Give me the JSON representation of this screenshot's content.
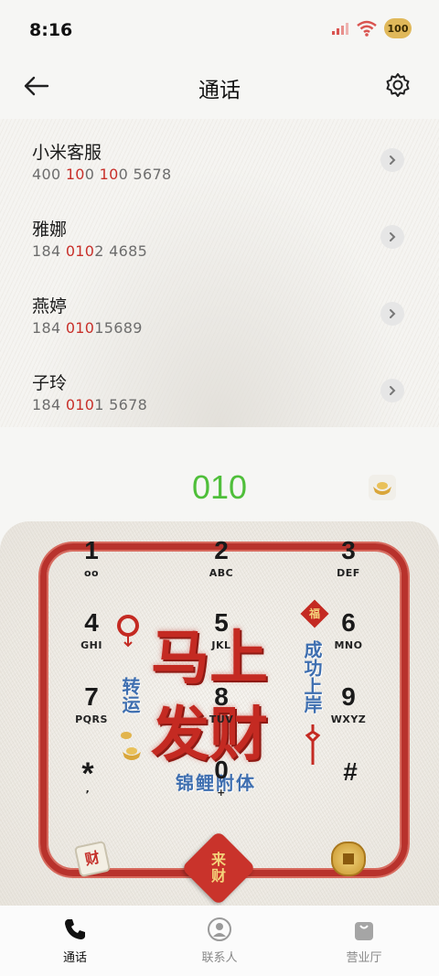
{
  "status_bar": {
    "time": "8:16",
    "battery": "100"
  },
  "header": {
    "title": "通话"
  },
  "contacts": [
    {
      "name": "小米客服",
      "number_pre": "400 ",
      "number_hl": "100",
      "number_post": " 5678",
      "number_hl_parts": [
        "10"
      ],
      "full": "400 100 5678"
    },
    {
      "name": "雅娜",
      "number_pre": "184 ",
      "number_hl": "010",
      "number_post": "2 4685"
    },
    {
      "name": "燕婷",
      "number_pre": "184 ",
      "number_hl": "010",
      "number_post": "15689"
    },
    {
      "name": "子玲",
      "number_pre": "184 ",
      "number_hl": "010",
      "number_post": "1 5678"
    }
  ],
  "contact0_parts": {
    "a": "400 ",
    "b": "10",
    "c": "0 ",
    "d": "10",
    "e": "0 5678"
  },
  "dial": {
    "input": "010"
  },
  "keypad": [
    {
      "digit": "1",
      "letters": "oo"
    },
    {
      "digit": "2",
      "letters": "ABC"
    },
    {
      "digit": "3",
      "letters": "DEF"
    },
    {
      "digit": "4",
      "letters": "GHI"
    },
    {
      "digit": "5",
      "letters": "JKL"
    },
    {
      "digit": "6",
      "letters": "MNO"
    },
    {
      "digit": "7",
      "letters": "PQRS"
    },
    {
      "digit": "8",
      "letters": "TUV"
    },
    {
      "digit": "9",
      "letters": "WXYZ"
    },
    {
      "digit": "*",
      "letters": ","
    },
    {
      "digit": "0",
      "letters": "+"
    },
    {
      "digit": "#",
      "letters": ""
    }
  ],
  "decoration": {
    "big_line1": "马上",
    "big_line2": "发财",
    "left_vertical": "转运",
    "right_vertical": "成功上岸",
    "bottom_text": "锦鲤附体",
    "fu": "福",
    "tile": "财"
  },
  "call_button": {
    "line1": "来",
    "line2": "财"
  },
  "bottom_nav": [
    {
      "label": "通话",
      "icon": "phone-icon",
      "active": true
    },
    {
      "label": "联系人",
      "icon": "person-icon",
      "active": false
    },
    {
      "label": "营业厅",
      "icon": "bag-icon",
      "active": false
    }
  ],
  "colors": {
    "accent_green": "#4fbf3a",
    "highlight_red": "#c8302a",
    "festive_red": "#b8322c"
  }
}
